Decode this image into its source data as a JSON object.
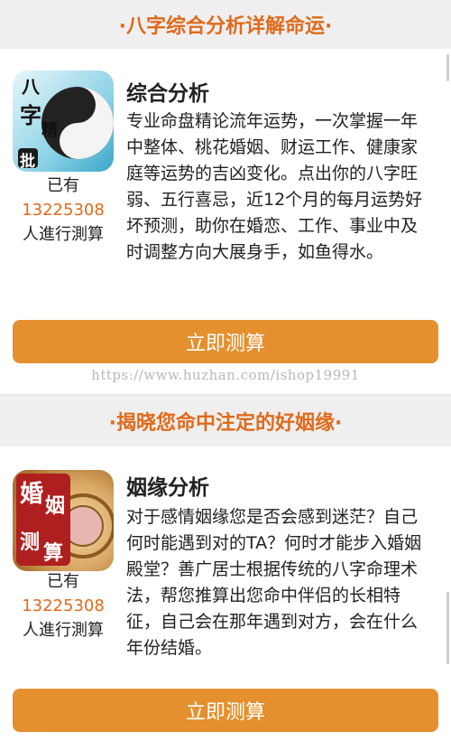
{
  "sections": [
    {
      "banner": "·八字综合分析详解命运·",
      "icon_name": "bazi-yinyang-icon",
      "icon_text": [
        "八",
        "字",
        "精",
        "批"
      ],
      "title": "综合分析",
      "stats_prefix": "已有",
      "stats_count": "13225308",
      "stats_suffix": "人進行測算",
      "description": "专业命盘精论流年运势，一次掌握一年中整体、桃花婚姻、财运工作、健康家庭等运势的吉凶变化。点出你的八字旺弱、五行喜忌，近12个月的每月运势好坏预测，助你在婚恋、工作、事业中及时调整方向大展身手，如鱼得水。",
      "button": "立即测算"
    },
    {
      "banner": "·揭晓您命中注定的好姻缘·",
      "icon_name": "marriage-seal-icon",
      "icon_text": [
        "婚",
        "姻",
        "测",
        "算"
      ],
      "title": "姻缘分析",
      "stats_prefix": "已有",
      "stats_count": "13225308",
      "stats_suffix": "人進行測算",
      "description": "对于感情姻缘您是否会感到迷茫？自己何时能遇到对的TA？何时才能步入婚姻殿堂？善广居士根据传统的八字命理术法，帮您推算出您命中伴侣的长相特征，自己会在那年遇到对方，会在什么年份结婚。",
      "button": "立即测算"
    }
  ],
  "watermark": "https://www.huzhan.com/ishop19991",
  "colors": {
    "accent": "#e06a1b",
    "button": "#e5902f",
    "banner_bg": "#efefef"
  }
}
